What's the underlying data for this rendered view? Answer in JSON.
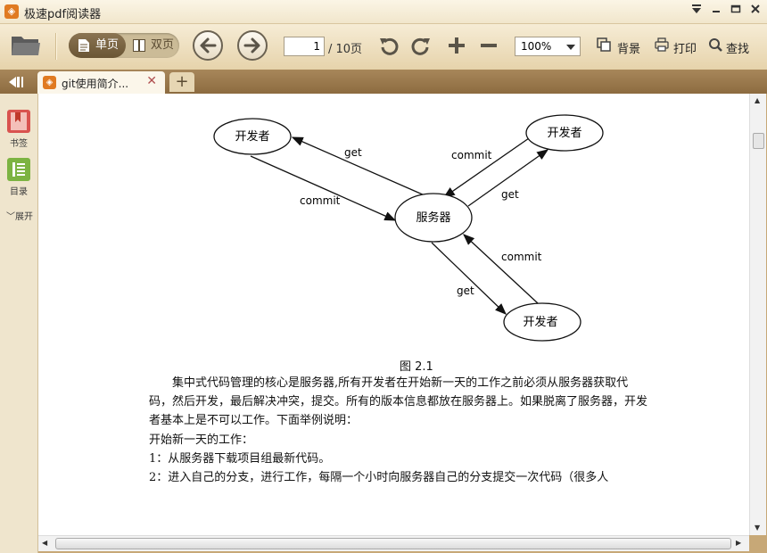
{
  "window": {
    "title": "极速pdf阅读器",
    "app_icon": "pdf-app-icon"
  },
  "toolbar": {
    "single_page": "单页",
    "double_page": "双页",
    "current_page": "1",
    "total_pages": "/ 10页",
    "zoom": "100%",
    "background": "背景",
    "print": "打印",
    "find": "查找"
  },
  "tabs": [
    {
      "label": "git使用简介..."
    }
  ],
  "sidebar": {
    "bookmarks": "书签",
    "toc": "目录",
    "expand": "展开"
  },
  "document": {
    "diagram": {
      "nodes": {
        "dev_top_left": "开发者",
        "dev_top_right": "开发者",
        "server": "服务器",
        "dev_bottom": "开发者"
      },
      "edges": {
        "get_left": "get",
        "commit_left": "commit",
        "commit_right": "commit",
        "get_right": "get",
        "commit_bottom": "commit",
        "get_bottom": "get"
      }
    },
    "caption": "图 2.1",
    "paragraphs": [
      "　　集中式代码管理的核心是服务器,所有开发者在开始新一天的工作之前必须从服务器获取代码，然后开发，最后解决冲突，提交。所有的版本信息都放在服务器上。如果脱离了服务器，开发者基本上是不可以工作。下面举例说明：",
      "开始新一天的工作：",
      "1：从服务器下载项目组最新代码。",
      "2：进入自己的分支，进行工作，每隔一个小时向服务器自己的分支提交一次代码（很多人"
    ]
  },
  "colors": {
    "accent": "#e07a21",
    "toolbar_bg": "#f1e6cc",
    "tabbar_bg": "#9c7a4c"
  }
}
